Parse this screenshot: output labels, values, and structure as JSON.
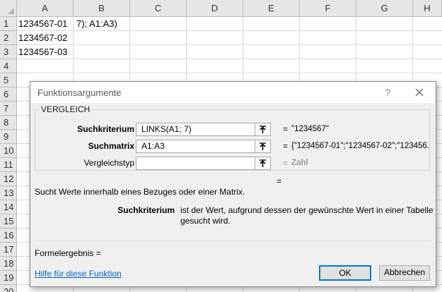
{
  "sheet": {
    "columns": [
      "A",
      "B",
      "C",
      "D",
      "E",
      "F",
      "G",
      "H"
    ],
    "rows": [
      "1",
      "2",
      "3",
      "4",
      "5",
      "6",
      "7",
      "8",
      "9",
      "10",
      "11",
      "12",
      "13",
      "14",
      "15",
      "16",
      "17",
      "18",
      "19",
      "20"
    ],
    "cells": {
      "a1": "1234567-01",
      "b1": "7); A1:A3)",
      "a2": "1234567-02",
      "a3": "1234567-03"
    }
  },
  "dialog": {
    "title": "Funktionsargumente",
    "help_label": "?",
    "function_name": "VERGLEICH",
    "arguments": [
      {
        "label": "Suchkriterium",
        "value": "LINKS(A1; 7)",
        "equals": "=",
        "result": "\"1234567\""
      },
      {
        "label": "Suchmatrix",
        "value": "A1:A3",
        "equals": "=",
        "result": "{\"1234567-01\";\"1234567-02\";\"123456..."
      },
      {
        "label": "Vergleichstyp",
        "value": "",
        "equals": "=",
        "result": "Zahl"
      }
    ],
    "function_equals": "=",
    "function_description": "Sucht Werte innerhalb eines Bezuges oder einer Matrix.",
    "param_name": "Suchkriterium",
    "param_description": "ist der Wert, aufgrund dessen der gewünschte Wert in einer Tabelle gesucht wird.",
    "formula_result_label": "Formelergebnis =",
    "help_link": "Hilfe für diese Funktion",
    "ok_label": "OK",
    "cancel_label": "Abbrechen"
  }
}
